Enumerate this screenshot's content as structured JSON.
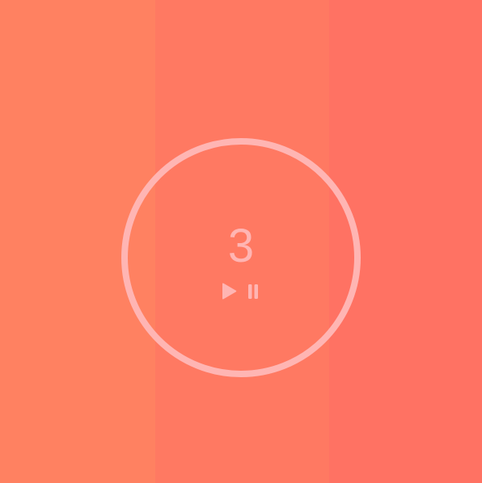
{
  "timer": {
    "count": "3"
  },
  "controls": {
    "play_icon": "play-icon",
    "pause_icon": "pause-icon"
  },
  "colors": {
    "background_left": "#ff8161",
    "background_middle": "#ff7962",
    "background_right": "#ff7263",
    "accent": "#ffb5b3"
  }
}
